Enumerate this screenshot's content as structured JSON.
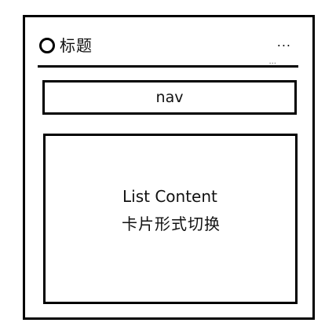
{
  "header": {
    "title": "标题",
    "more": "...",
    "rule_dots": "..."
  },
  "nav": {
    "label": "nav"
  },
  "list": {
    "line1": "List Content",
    "line2": "卡片形式切换"
  },
  "icons": {
    "header_icon": "circle-icon",
    "more_icon": "ellipsis-icon"
  },
  "colors": {
    "stroke": "#000000",
    "background": "#ffffff"
  }
}
